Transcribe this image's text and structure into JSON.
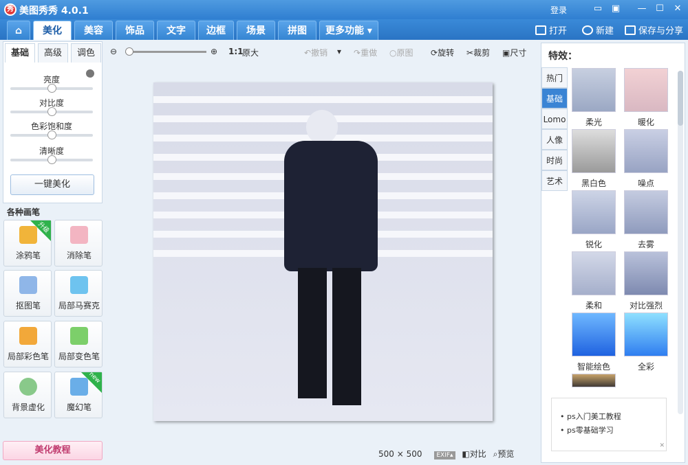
{
  "app": {
    "title": "美图秀秀 4.0.1",
    "logo": "秀",
    "login": "登录"
  },
  "nav": {
    "tabs": [
      "美化",
      "美容",
      "饰品",
      "文字",
      "边框",
      "场景",
      "拼图",
      "更多功能 ▾"
    ],
    "active": 0,
    "open": "打开",
    "new": "新建",
    "save": "保存与分享"
  },
  "left": {
    "subtabs": [
      "基础",
      "高级",
      "调色"
    ],
    "sliders": [
      {
        "label": "亮度",
        "value": 0.5
      },
      {
        "label": "对比度",
        "value": 0.5
      },
      {
        "label": "色彩饱和度",
        "value": 0.5
      },
      {
        "label": "清晰度",
        "value": 0.5
      }
    ],
    "onekey": "一键美化",
    "section": "各种画笔",
    "tools": [
      {
        "label": "涂鸦笔",
        "badge": "升级"
      },
      {
        "label": "消除笔",
        "badge": ""
      },
      {
        "label": "抠图笔",
        "badge": ""
      },
      {
        "label": "局部马赛克",
        "badge": ""
      },
      {
        "label": "局部彩色笔",
        "badge": ""
      },
      {
        "label": "局部变色笔",
        "badge": ""
      },
      {
        "label": "背景虚化",
        "badge": ""
      },
      {
        "label": "魔幻笔",
        "badge": "new"
      }
    ],
    "tutorial": "美化教程"
  },
  "toolbar": {
    "ratio": "1:1",
    "original": "原大",
    "undo": "撤销",
    "redo": "重做",
    "orig": "原图",
    "rotate": "旋转",
    "crop": "裁剪",
    "size": "尺寸"
  },
  "status": {
    "width": "500",
    "x": "×",
    "height": "500",
    "exif": "EXIF▴",
    "compare": "对比",
    "preview": "预览"
  },
  "right": {
    "title": "特效：",
    "cats": [
      "热门",
      "基础",
      "Lomo",
      "人像",
      "时尚",
      "艺术"
    ],
    "activeCat": 1,
    "effects": [
      "柔光",
      "暖化",
      "黑白色",
      "噪点",
      "锐化",
      "去雾",
      "柔和",
      "对比强烈",
      "智能绘色",
      "全彩"
    ],
    "ad": [
      "ps入门美工教程",
      "ps零基础学习"
    ]
  }
}
